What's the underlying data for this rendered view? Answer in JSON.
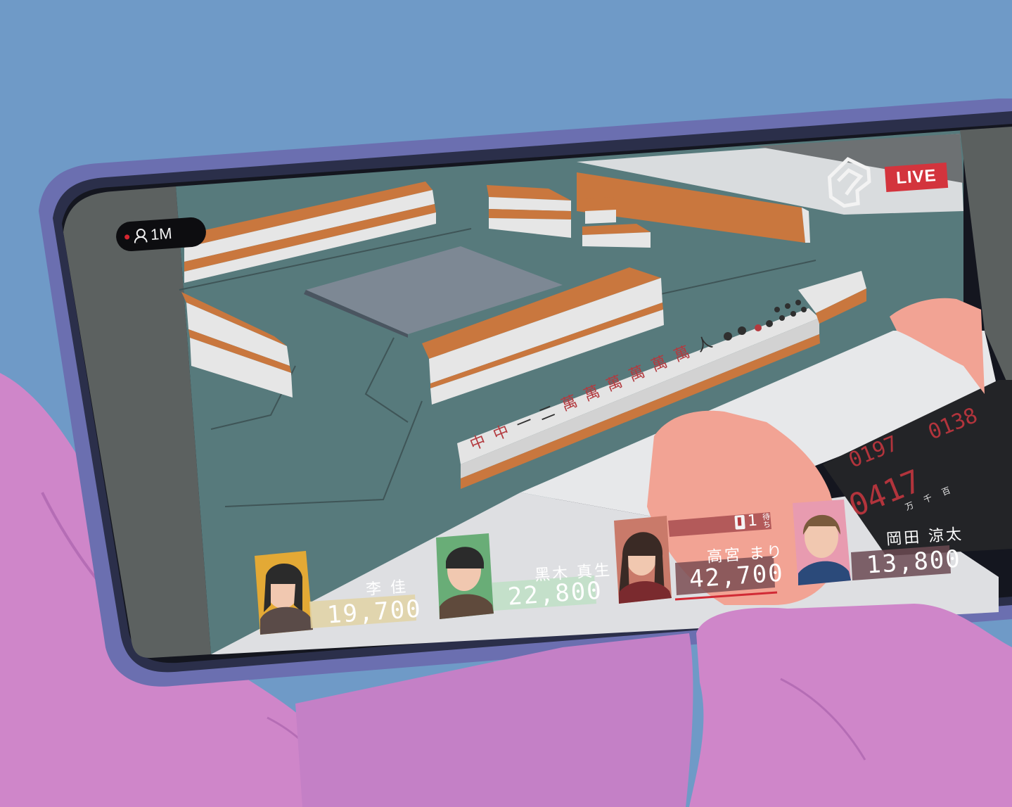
{
  "stream": {
    "viewer_count": "1M",
    "live_label": "LIVE"
  },
  "players": [
    {
      "name": "李 佳",
      "score": "19,700"
    },
    {
      "name": "黑木 真生",
      "score": "22,800"
    },
    {
      "name": "高宮 まり",
      "score": "42,700",
      "wait_label": "待ち",
      "wait_tile": "1"
    },
    {
      "name": "岡田 涼太",
      "score": "13,800"
    }
  ],
  "counter": {
    "left_digits": "0197",
    "right_digits": "0138",
    "main_digits": "0417",
    "unit_labels": [
      "万",
      "千",
      "百"
    ]
  },
  "colors": {
    "background": "#6f9ac7",
    "hand": "#cf86c9",
    "phone_frame": "#6b6fb0",
    "table_felt": "#577a7c",
    "tile_back": "#c9773e",
    "live_red": "#d3343d"
  }
}
